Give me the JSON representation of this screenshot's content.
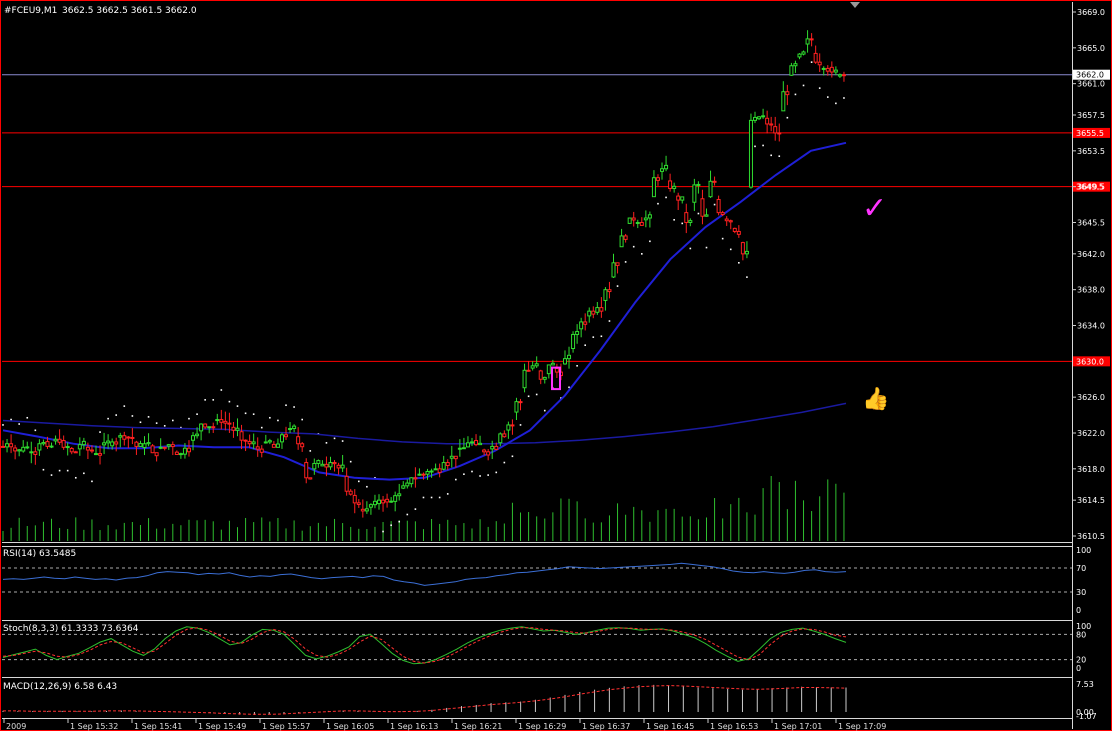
{
  "window": {
    "symbol": "#FCEU9,M1",
    "ohlc": "3662.5 3662.5 3661.5 3662.0",
    "border_color": "#ff0000"
  },
  "chart_data": [
    {
      "type": "candlestick",
      "panel": "price",
      "symbol": "#FCEU9",
      "timeframe": "M1",
      "y_ticks": [
        "3669.0",
        "3665.0",
        "3661.0",
        "3657.5",
        "3653.5",
        "3649.5",
        "3645.5",
        "3642.0",
        "3638.0",
        "3634.0",
        "3626.0",
        "3622.0",
        "3618.0",
        "3614.5",
        "3610.5"
      ],
      "ylim": [
        3610.5,
        3669.0
      ],
      "current_price": "3662.0",
      "levels": [
        {
          "value": "3655.5",
          "color": "#ff0000"
        },
        {
          "value": "3649.5",
          "color": "#ff0000"
        },
        {
          "value": "3630.0",
          "color": "#ff0000"
        }
      ],
      "x_ticks": [
        "2009",
        "1 Sep 15:32",
        "1 Sep 15:41",
        "1 Sep 15:49",
        "1 Sep 15:57",
        "1 Sep 16:05",
        "1 Sep 16:13",
        "1 Sep 16:21",
        "1 Sep 16:29",
        "1 Sep 16:37",
        "1 Sep 16:45",
        "1 Sep 16:53",
        "1 Sep 17:01",
        "1 Sep 17:09"
      ],
      "close_path": [
        3620.5,
        3620.8,
        3620.0,
        3620.4,
        3619.9,
        3620.8,
        3620.5,
        3621.3,
        3620.4,
        3619.9,
        3620.7,
        3620.1,
        3619.7,
        3620.9,
        3621.0,
        3621.7,
        3621.5,
        3620.5,
        3620.8,
        3619.8,
        3620.4,
        3620.7,
        3619.6,
        3620.3,
        3621.7,
        3623.0,
        3622.7,
        3623.5,
        3623.1,
        3622.3,
        3621.2,
        3620.8,
        3620.2,
        3621.0,
        3620.4,
        3621.8,
        3622.5,
        3620.8,
        3617.0,
        3618.6,
        3618.5,
        3618.7,
        3618.1,
        3615.5,
        3614.2,
        3613.3,
        3614.0,
        3614.5,
        3614.3,
        3615.0,
        3616.1,
        3617.0,
        3617.4,
        3617.7,
        3618.0,
        3618.7,
        3619.4,
        3620.3,
        3620.9,
        3620.7,
        3619.9,
        3620.5,
        3621.9,
        3622.9,
        3625.5,
        3629.0,
        3629.5,
        3628.0,
        3629.6,
        3628.8,
        3630.3,
        3633.0,
        3634.4,
        3635.6,
        3636.0,
        3638.0,
        3641.0,
        3644.0,
        3646.0,
        3645.5,
        3646.0,
        3650.5,
        3651.5,
        3649.3,
        3648.0,
        3645.5,
        3649.7,
        3646.2,
        3650.1,
        3646.6,
        3645.7,
        3644.5,
        3642.0,
        3656.9,
        3657.3,
        3656.5,
        3655.5,
        3660.1,
        3663.0,
        3664.3,
        3666.0,
        3663.4,
        3662.7,
        3662.3,
        3662.0
      ],
      "series": [
        {
          "name": "MA blue fast",
          "type": "line",
          "color": "#1f1fd6",
          "values": [
            3622.3,
            3621.6,
            3620.8,
            3620.3,
            3620.3,
            3620.6,
            3620.4,
            3620.4,
            3619.3,
            3617.6,
            3617.0,
            3616.8,
            3617.0,
            3618.3,
            3620.0,
            3622.3,
            3626.2,
            3631.2,
            3636.6,
            3641.4,
            3645.0,
            3647.8,
            3650.8,
            3653.5,
            3654.4
          ]
        },
        {
          "name": "MA blue slow",
          "type": "line",
          "color": "#1a1aa0",
          "values": [
            3623.4,
            3623.1,
            3622.8,
            3622.6,
            3622.5,
            3622.4,
            3622.1,
            3621.9,
            3621.4,
            3621.0,
            3620.8,
            3620.8,
            3620.9,
            3621.2,
            3621.6,
            3622.1,
            3622.7,
            3623.5,
            3624.3,
            3625.3
          ]
        },
        {
          "name": "Parabolic SAR",
          "type": "dots",
          "color": "#ffffff"
        },
        {
          "name": "Volume",
          "type": "bars",
          "color": "#2fbf2f"
        }
      ]
    },
    {
      "type": "line",
      "panel": "RSI",
      "label": "RSI(14) 63.5485",
      "y_ticks": [
        "100",
        "70",
        "30",
        "0"
      ],
      "ylim": [
        0,
        100
      ],
      "levels": [
        70,
        30
      ],
      "series": [
        {
          "name": "RSI(14)",
          "color": "#3b6fd6",
          "values": [
            51,
            52,
            51,
            53,
            55,
            53,
            52,
            55,
            53,
            51,
            52,
            50,
            53,
            54,
            57,
            62,
            64,
            63,
            62,
            59,
            61,
            60,
            62,
            58,
            55,
            57,
            56,
            59,
            60,
            57,
            54,
            52,
            54,
            55,
            56,
            54,
            57,
            56,
            50,
            47,
            45,
            41,
            43,
            45,
            47,
            51,
            53,
            54,
            57,
            59,
            62,
            63,
            65,
            67,
            69,
            72,
            71,
            70,
            69,
            70,
            71,
            72,
            73,
            74,
            75,
            76,
            78,
            76,
            74,
            72,
            69,
            65,
            63,
            62,
            64,
            62,
            61,
            63,
            66,
            67,
            64,
            63,
            64
          ]
        }
      ]
    },
    {
      "type": "line",
      "panel": "Stochastic",
      "label": "Stoch(8,3,3) 61.3333 73.6364",
      "y_ticks": [
        "100",
        "80",
        "20",
        "0"
      ],
      "ylim": [
        0,
        100
      ],
      "levels": [
        80,
        20
      ],
      "series": [
        {
          "name": "%K",
          "color": "#2fbf2f",
          "values": [
            25,
            32,
            38,
            45,
            30,
            20,
            28,
            35,
            48,
            62,
            70,
            55,
            40,
            30,
            45,
            70,
            88,
            98,
            95,
            85,
            70,
            55,
            60,
            78,
            92,
            90,
            80,
            55,
            30,
            22,
            28,
            38,
            50,
            75,
            80,
            58,
            35,
            18,
            10,
            12,
            20,
            32,
            45,
            60,
            72,
            82,
            90,
            95,
            98,
            93,
            88,
            90,
            85,
            80,
            84,
            90,
            95,
            96,
            94,
            90,
            92,
            93,
            88,
            80,
            72,
            58,
            42,
            28,
            16,
            22,
            45,
            70,
            85,
            92,
            95,
            88,
            80,
            70,
            61
          ]
        },
        {
          "name": "%D",
          "color": "#ff3030",
          "values": [
            28,
            30,
            35,
            40,
            36,
            28,
            26,
            32,
            42,
            55,
            63,
            60,
            48,
            36,
            40,
            58,
            78,
            92,
            96,
            90,
            78,
            64,
            58,
            68,
            84,
            92,
            86,
            68,
            45,
            30,
            26,
            32,
            44,
            62,
            76,
            68,
            48,
            28,
            16,
            12,
            16,
            25,
            38,
            52,
            65,
            76,
            85,
            92,
            96,
            96,
            92,
            90,
            88,
            84,
            83,
            87,
            92,
            95,
            95,
            93,
            92,
            92,
            90,
            85,
            78,
            68,
            54,
            40,
            26,
            20,
            32,
            56,
            76,
            88,
            93,
            92,
            86,
            78,
            74
          ]
        }
      ]
    },
    {
      "type": "bar",
      "panel": "MACD",
      "label": "MACD(12,26,9) 6.58 6.43",
      "y_ticks": [
        "7.53",
        "0.00",
        "-1.07"
      ],
      "ylim": [
        -1.07,
        7.53
      ],
      "series": [
        {
          "name": "MACD",
          "color": "#cccccc",
          "values": [
            0.3,
            0.2,
            0.2,
            0.2,
            0.3,
            0.2,
            0.2,
            0.3,
            0.4,
            0.2,
            0.1,
            0.1,
            0.0,
            -0.2,
            -0.3,
            -0.5,
            -0.7,
            -0.8,
            -0.7,
            -0.5,
            -0.3,
            0.0,
            0.3,
            0.4,
            0.3,
            0.1,
            0.0,
            0.1,
            0.3,
            0.6,
            1.1,
            1.6,
            1.9,
            2.4,
            2.6,
            2.8,
            3.3,
            3.9,
            4.6,
            5.4,
            6.0,
            6.5,
            6.9,
            7.2,
            7.3,
            7.2,
            6.9,
            6.6,
            6.4,
            6.2,
            6.0,
            6.1,
            6.4,
            6.6,
            6.8,
            6.7,
            6.6,
            6.58
          ]
        },
        {
          "name": "Signal",
          "color": "#ff3030",
          "values": [
            0.3,
            0.3,
            0.2,
            0.2,
            0.2,
            0.2,
            0.2,
            0.3,
            0.3,
            0.3,
            0.2,
            0.1,
            0.0,
            -0.1,
            -0.2,
            -0.4,
            -0.5,
            -0.6,
            -0.6,
            -0.5,
            -0.3,
            -0.1,
            0.1,
            0.3,
            0.3,
            0.2,
            0.1,
            0.1,
            0.2,
            0.4,
            0.8,
            1.2,
            1.6,
            2.0,
            2.3,
            2.6,
            3.0,
            3.5,
            4.1,
            4.8,
            5.4,
            6.0,
            6.4,
            6.8,
            7.0,
            7.1,
            7.0,
            6.8,
            6.6,
            6.4,
            6.2,
            6.1,
            6.2,
            6.4,
            6.6,
            6.6,
            6.5,
            6.43
          ]
        }
      ]
    }
  ],
  "annotations": {
    "check_mark": "✓",
    "thumbs_up": "👍",
    "check_color": "#ff33ff"
  }
}
